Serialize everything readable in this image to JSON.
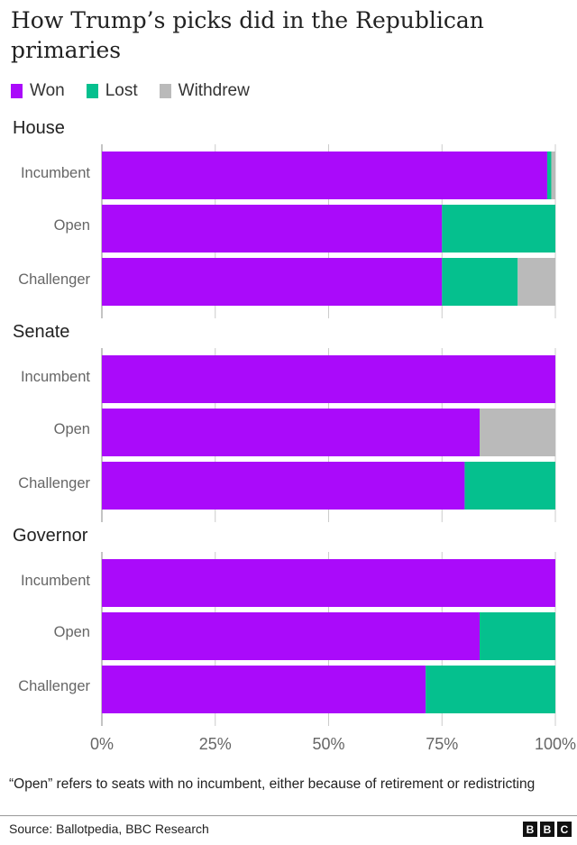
{
  "title": "How Trump’s picks did in the Republican primaries",
  "legend": [
    {
      "label": "Won",
      "color": "#aa0afa"
    },
    {
      "label": "Lost",
      "color": "#05c08e"
    },
    {
      "label": "Withdrew",
      "color": "#bababa"
    }
  ],
  "note": "“Open” refers to seats with no incumbent, either because of retirement or redistricting",
  "source": "Source: Ballotpedia, BBC Research",
  "logo": [
    "B",
    "B",
    "C"
  ],
  "chart_data": {
    "type": "bar",
    "orientation": "horizontal-stacked-100",
    "title": "How Trump’s picks did in the Republican primaries",
    "xlabel": "",
    "ylabel": "",
    "xlim": [
      0,
      100
    ],
    "x_ticks": [
      "0%",
      "25%",
      "50%",
      "75%",
      "100%"
    ],
    "grid": true,
    "legend_position": "top-left",
    "series_names": [
      "Won",
      "Lost",
      "Withdrew"
    ],
    "groups": [
      {
        "name": "House",
        "categories": [
          "Incumbent",
          "Open",
          "Challenger"
        ],
        "series": [
          {
            "name": "Won",
            "values": [
              98.2,
              75,
              75
            ]
          },
          {
            "name": "Lost",
            "values": [
              0.9,
              25,
              16.7
            ]
          },
          {
            "name": "Withdrew",
            "values": [
              0.9,
              0,
              8.3
            ]
          }
        ]
      },
      {
        "name": "Senate",
        "categories": [
          "Incumbent",
          "Open",
          "Challenger"
        ],
        "series": [
          {
            "name": "Won",
            "values": [
              100,
              83.3,
              80
            ]
          },
          {
            "name": "Lost",
            "values": [
              0,
              0,
              20
            ]
          },
          {
            "name": "Withdrew",
            "values": [
              0,
              16.7,
              0
            ]
          }
        ]
      },
      {
        "name": "Governor",
        "categories": [
          "Incumbent",
          "Open",
          "Challenger"
        ],
        "series": [
          {
            "name": "Won",
            "values": [
              100,
              83.3,
              71.4
            ]
          },
          {
            "name": "Lost",
            "values": [
              0,
              16.7,
              28.6
            ]
          },
          {
            "name": "Withdrew",
            "values": [
              0,
              0,
              0
            ]
          }
        ]
      }
    ]
  }
}
